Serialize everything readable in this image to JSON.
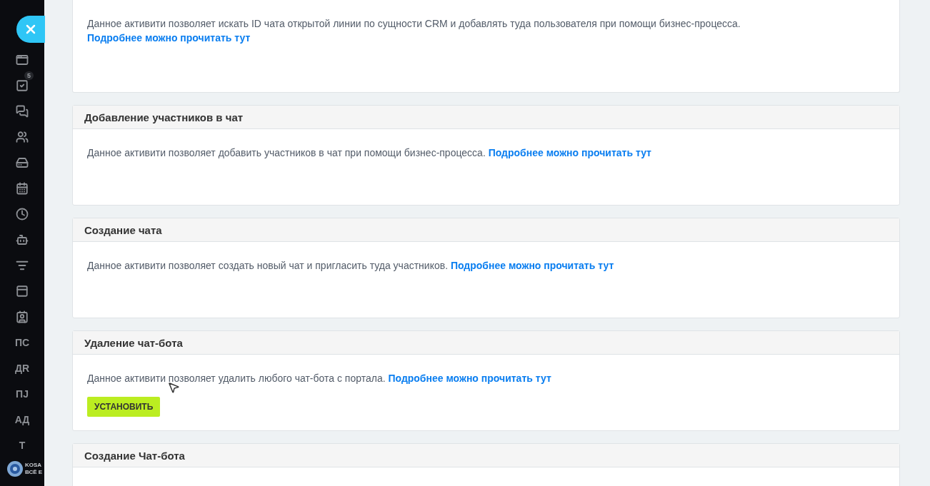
{
  "sidebar": {
    "items": [
      {
        "kind": "icon"
      },
      {
        "kind": "icon",
        "badge": "5"
      },
      {
        "kind": "icon"
      },
      {
        "kind": "icon"
      },
      {
        "kind": "icon"
      },
      {
        "kind": "icon"
      },
      {
        "kind": "icon"
      },
      {
        "kind": "icon"
      },
      {
        "kind": "icon"
      },
      {
        "kind": "icon"
      },
      {
        "kind": "icon"
      },
      {
        "kind": "text",
        "label": "ПС"
      },
      {
        "kind": "text",
        "label": "ДR"
      },
      {
        "kind": "text",
        "label": "ПЈ"
      },
      {
        "kind": "text",
        "label": "АД"
      },
      {
        "kind": "text",
        "label": "Т"
      }
    ],
    "logo": {
      "line_1": "KOSA",
      "line_2": "ВСЁ Е"
    }
  },
  "cards": [
    {
      "description": "Данное активити позволяет искать ID чата открытой линии по сущности CRM и добавлять туда пользователя при помощи бизнес-процесса.",
      "link": "Подробнее можно прочитать тут"
    },
    {
      "title": "Добавление участников в чат",
      "description": "Данное активити позволяет добавить участников в чат при помощи бизнес-процесса.",
      "link": "Подробнее можно прочитать тут"
    },
    {
      "title": "Создание чата",
      "description": "Данное активити позволяет создать новый чат и пригласить туда участников.",
      "link": "Подробнее можно прочитать тут"
    },
    {
      "title": "Удаление чат-бота",
      "description": "Данное активити позволяет удалить любого чат-бота с портала.",
      "link": "Подробнее можно прочитать тут",
      "button": "УСТАНОВИТЬ"
    },
    {
      "title": "Создание Чат-бота"
    }
  ]
}
